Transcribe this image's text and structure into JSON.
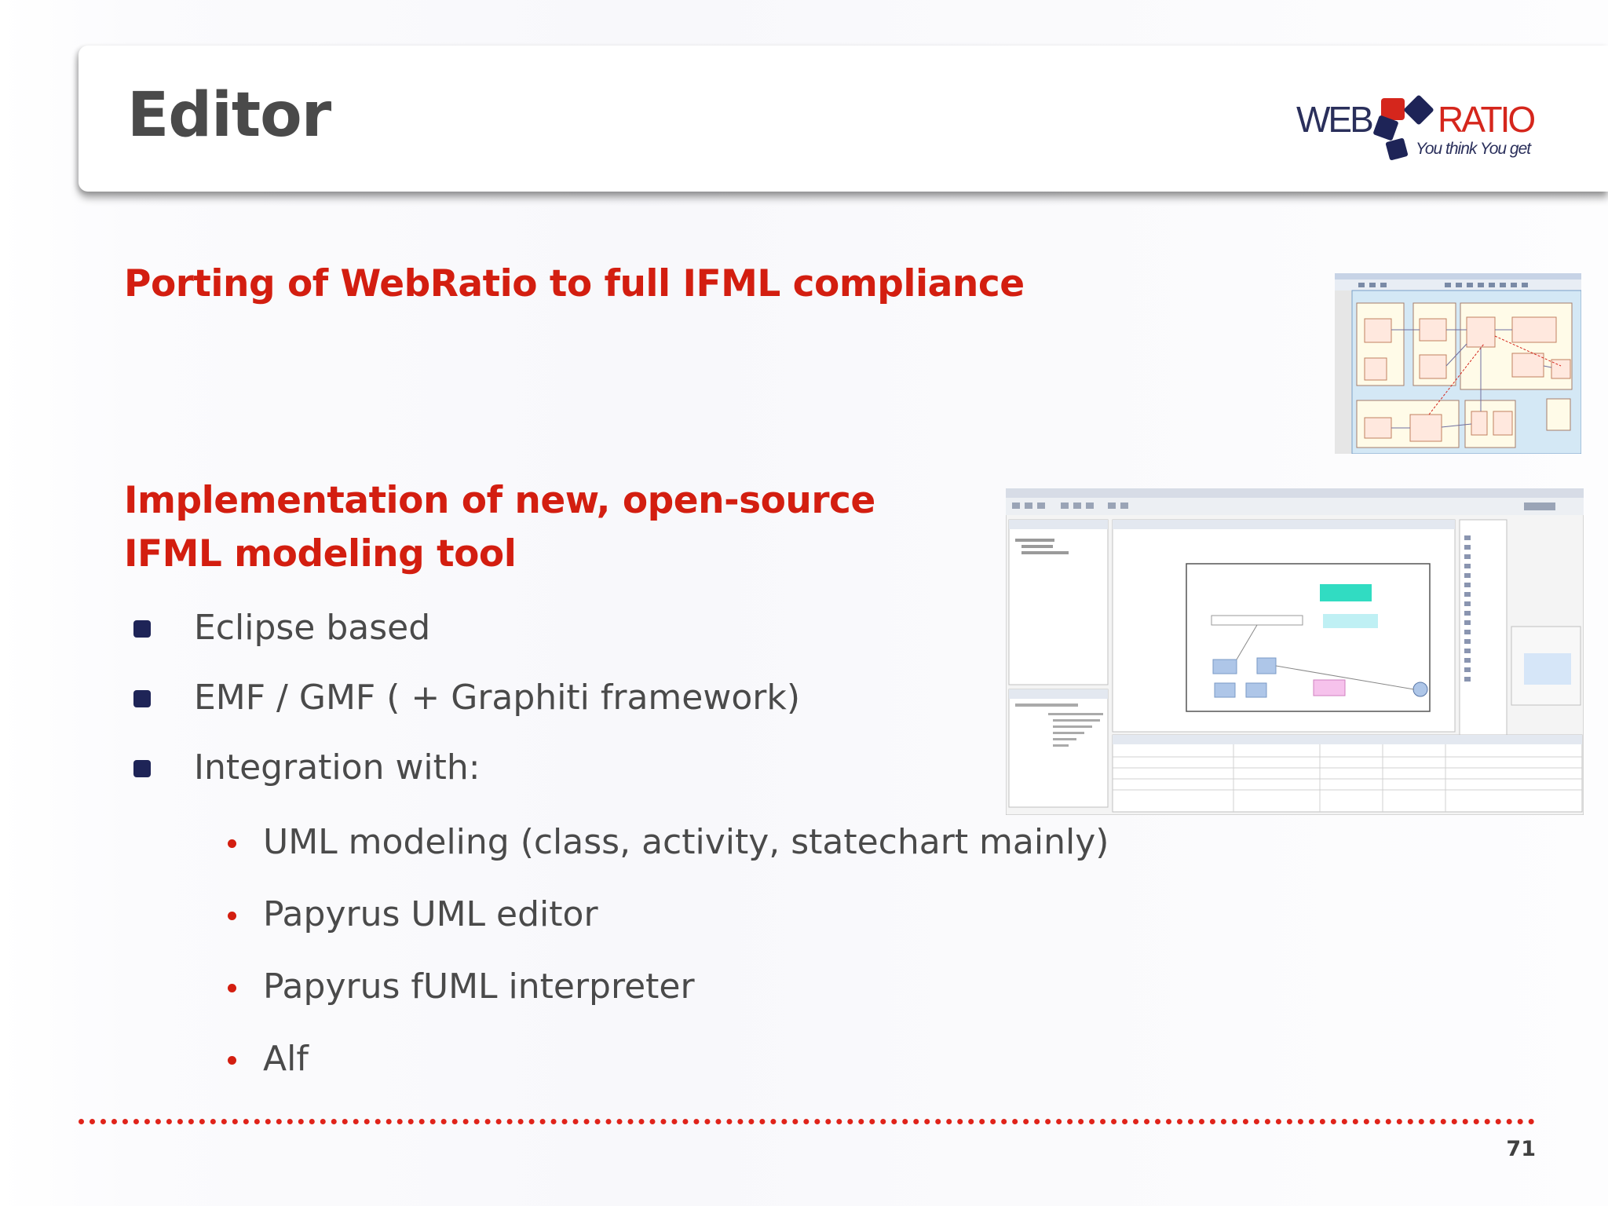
{
  "slide": {
    "title": "Editor",
    "page_number": "71"
  },
  "logo": {
    "left_text": "WEB",
    "right_text": "RATIO",
    "tagline": "You think You get",
    "colors": {
      "navy": "#1e2457",
      "red": "#d5261c"
    }
  },
  "section1": {
    "heading": "Porting of WebRatio to full IFML compliance"
  },
  "section2": {
    "heading_line1": "Implementation of new, open-source",
    "heading_line2": "IFML modeling tool",
    "bullets": [
      "Eclipse based",
      "EMF / GMF ( + Graphiti framework)",
      "Integration with:"
    ],
    "sub_bullets": [
      "UML modeling (class, activity, statechart mainly)",
      "Papyrus UML editor",
      "Papyrus fUML interpreter",
      "Alf"
    ]
  },
  "colors": {
    "heading_red": "#d31e10",
    "body_gray": "#4a4a4a",
    "bullet_navy": "#1e2457"
  }
}
